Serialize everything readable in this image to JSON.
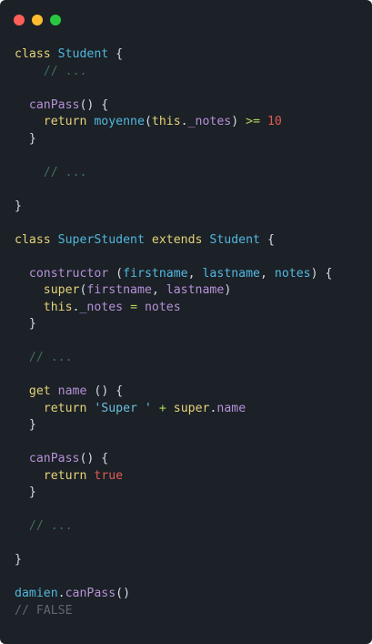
{
  "window": {
    "controls": [
      "close-control",
      "minimize-control",
      "zoom-control"
    ],
    "colors": {
      "background": "#1b2126",
      "close": "#ff5f57",
      "minimize": "#febc2e",
      "zoom": "#28c840"
    }
  },
  "code": {
    "lines": [
      [
        {
          "t": "kw",
          "v": "class"
        },
        {
          "t": "pn",
          "v": " "
        },
        {
          "t": "cls",
          "v": "Student"
        },
        {
          "t": "pn",
          "v": " {"
        }
      ],
      [
        {
          "t": "pn",
          "v": "    "
        },
        {
          "t": "cmt",
          "v": "// ..."
        }
      ],
      [],
      [
        {
          "t": "pn",
          "v": "  "
        },
        {
          "t": "fn",
          "v": "canPass"
        },
        {
          "t": "pn",
          "v": "() {"
        }
      ],
      [
        {
          "t": "pn",
          "v": "    "
        },
        {
          "t": "kw",
          "v": "return"
        },
        {
          "t": "pn",
          "v": " "
        },
        {
          "t": "cls",
          "v": "moyenne"
        },
        {
          "t": "pn",
          "v": "("
        },
        {
          "t": "self",
          "v": "this"
        },
        {
          "t": "pn",
          "v": "."
        },
        {
          "t": "prop",
          "v": "_notes"
        },
        {
          "t": "pn",
          "v": ") "
        },
        {
          "t": "op",
          "v": ">="
        },
        {
          "t": "pn",
          "v": " "
        },
        {
          "t": "num",
          "v": "10"
        }
      ],
      [
        {
          "t": "pn",
          "v": "  }"
        }
      ],
      [],
      [
        {
          "t": "pn",
          "v": "    "
        },
        {
          "t": "cmt",
          "v": "// ..."
        }
      ],
      [],
      [
        {
          "t": "pn",
          "v": "}"
        }
      ],
      [],
      [
        {
          "t": "kw",
          "v": "class"
        },
        {
          "t": "pn",
          "v": " "
        },
        {
          "t": "cls",
          "v": "SuperStudent"
        },
        {
          "t": "pn",
          "v": " "
        },
        {
          "t": "kw",
          "v": "extends"
        },
        {
          "t": "pn",
          "v": " "
        },
        {
          "t": "cls",
          "v": "Student"
        },
        {
          "t": "pn",
          "v": " {"
        }
      ],
      [],
      [
        {
          "t": "pn",
          "v": "  "
        },
        {
          "t": "fn",
          "v": "constructor"
        },
        {
          "t": "pn",
          "v": " ("
        },
        {
          "t": "prm",
          "v": "firstname"
        },
        {
          "t": "pn",
          "v": ", "
        },
        {
          "t": "prm",
          "v": "lastname"
        },
        {
          "t": "pn",
          "v": ", "
        },
        {
          "t": "prm",
          "v": "notes"
        },
        {
          "t": "pn",
          "v": ") {"
        }
      ],
      [
        {
          "t": "pn",
          "v": "    "
        },
        {
          "t": "kw",
          "v": "super"
        },
        {
          "t": "pn",
          "v": "("
        },
        {
          "t": "fn",
          "v": "firstname"
        },
        {
          "t": "pn",
          "v": ", "
        },
        {
          "t": "fn",
          "v": "lastname"
        },
        {
          "t": "pn",
          "v": ")"
        }
      ],
      [
        {
          "t": "pn",
          "v": "    "
        },
        {
          "t": "self",
          "v": "this"
        },
        {
          "t": "pn",
          "v": "."
        },
        {
          "t": "prop",
          "v": "_notes"
        },
        {
          "t": "pn",
          "v": " "
        },
        {
          "t": "op",
          "v": "="
        },
        {
          "t": "pn",
          "v": " "
        },
        {
          "t": "fn",
          "v": "notes"
        }
      ],
      [
        {
          "t": "pn",
          "v": "  }"
        }
      ],
      [],
      [
        {
          "t": "pn",
          "v": "  "
        },
        {
          "t": "cmt",
          "v": "// ..."
        }
      ],
      [],
      [
        {
          "t": "pn",
          "v": "  "
        },
        {
          "t": "kw",
          "v": "get"
        },
        {
          "t": "pn",
          "v": " "
        },
        {
          "t": "fn",
          "v": "name"
        },
        {
          "t": "pn",
          "v": " () {"
        }
      ],
      [
        {
          "t": "pn",
          "v": "    "
        },
        {
          "t": "kw",
          "v": "return"
        },
        {
          "t": "pn",
          "v": " "
        },
        {
          "t": "str",
          "v": "'Super '"
        },
        {
          "t": "pn",
          "v": " "
        },
        {
          "t": "op",
          "v": "+"
        },
        {
          "t": "pn",
          "v": " "
        },
        {
          "t": "kw",
          "v": "super"
        },
        {
          "t": "pn",
          "v": "."
        },
        {
          "t": "prop",
          "v": "name"
        }
      ],
      [
        {
          "t": "pn",
          "v": "  }"
        }
      ],
      [],
      [
        {
          "t": "pn",
          "v": "  "
        },
        {
          "t": "fn",
          "v": "canPass"
        },
        {
          "t": "pn",
          "v": "() {"
        }
      ],
      [
        {
          "t": "pn",
          "v": "    "
        },
        {
          "t": "kw",
          "v": "return"
        },
        {
          "t": "pn",
          "v": " "
        },
        {
          "t": "bool",
          "v": "true"
        }
      ],
      [
        {
          "t": "pn",
          "v": "  }"
        }
      ],
      [],
      [
        {
          "t": "pn",
          "v": "  "
        },
        {
          "t": "cmt",
          "v": "// ..."
        }
      ],
      [],
      [
        {
          "t": "pn",
          "v": "}"
        }
      ],
      [],
      [
        {
          "t": "cls",
          "v": "damien"
        },
        {
          "t": "pn",
          "v": "."
        },
        {
          "t": "fn",
          "v": "canPass"
        },
        {
          "t": "pn",
          "v": "()"
        }
      ],
      [
        {
          "t": "cmt-gray",
          "v": "// FALSE"
        }
      ]
    ]
  }
}
